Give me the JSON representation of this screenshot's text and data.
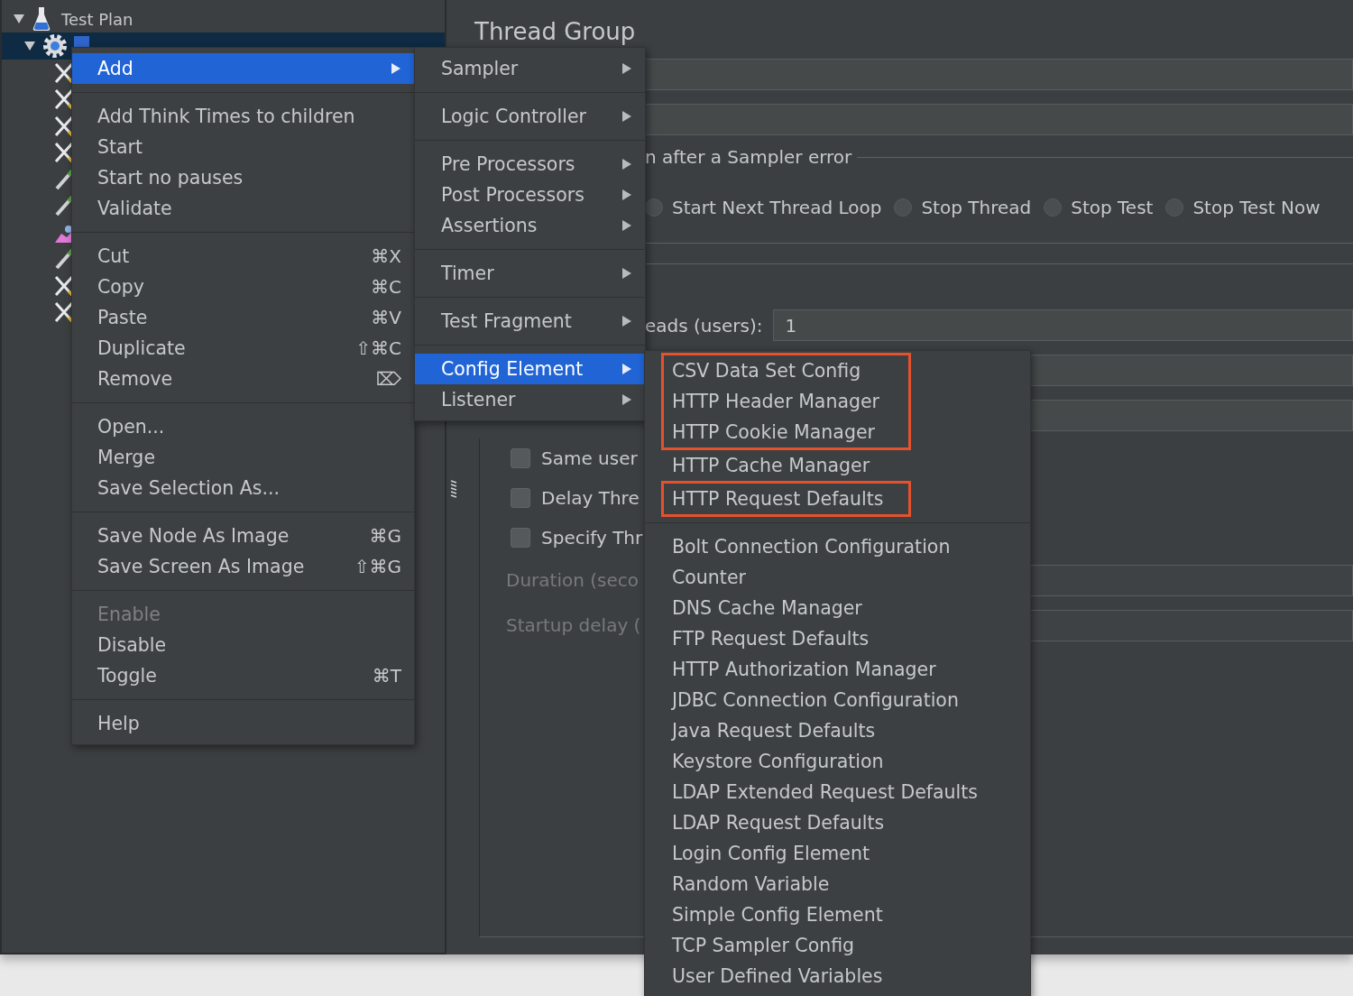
{
  "tree": {
    "label": "Test Plan",
    "kind": "flask",
    "expanded": true,
    "selected": false,
    "children": [
      {
        "kind": "gear",
        "expanded": true,
        "selected": true,
        "children": [
          {
            "kind": "tools",
            "selected": false
          },
          {
            "kind": "tools",
            "selected": false
          },
          {
            "kind": "tools",
            "selected": false
          },
          {
            "kind": "tools",
            "selected": false
          },
          {
            "kind": "pencil",
            "selected": false
          },
          {
            "kind": "pencil",
            "selected": false
          },
          {
            "kind": "chart",
            "selected": false
          },
          {
            "kind": "pencil",
            "selected": false
          },
          {
            "kind": "tools",
            "selected": false
          },
          {
            "kind": "tools",
            "selected": false
          }
        ]
      }
    ]
  },
  "panel": {
    "title": "Thread Group",
    "error_group": {
      "legend": "n after a Sampler error",
      "options": [
        {
          "label": "Start Next Thread Loop",
          "selected": false
        },
        {
          "label": "Stop Thread",
          "selected": false
        },
        {
          "label": "Stop Test",
          "selected": false
        },
        {
          "label": "Stop Test Now",
          "selected": false
        }
      ]
    },
    "threads": {
      "label": "eads (users):",
      "value": "1"
    },
    "checkboxes": [
      {
        "label": "Same user",
        "checked": false
      },
      {
        "label": "Delay Thre",
        "checked": false
      },
      {
        "label": "Specify Thr",
        "checked": false
      }
    ],
    "timing_fields": [
      {
        "label": "Duration (seco",
        "disabled": true
      },
      {
        "label": "Startup delay (",
        "disabled": true
      }
    ]
  },
  "context_menu": {
    "sections": [
      {
        "items": [
          {
            "label": "Add",
            "submenu": true,
            "selected": true,
            "disabled": false
          }
        ]
      },
      {
        "items": [
          {
            "label": "Add Think Times to children",
            "submenu": false,
            "selected": false,
            "disabled": false
          },
          {
            "label": "Start",
            "submenu": false,
            "selected": false,
            "disabled": false
          },
          {
            "label": "Start no pauses",
            "submenu": false,
            "selected": false,
            "disabled": false
          },
          {
            "label": "Validate",
            "submenu": false,
            "selected": false,
            "disabled": false
          }
        ]
      },
      {
        "items": [
          {
            "label": "Cut",
            "shortcut": "⌘X",
            "submenu": false,
            "selected": false,
            "disabled": false
          },
          {
            "label": "Copy",
            "shortcut": "⌘C",
            "submenu": false,
            "selected": false,
            "disabled": false
          },
          {
            "label": "Paste",
            "shortcut": "⌘V",
            "submenu": false,
            "selected": false,
            "disabled": false
          },
          {
            "label": "Duplicate",
            "shortcut": "⇧⌘C",
            "submenu": false,
            "selected": false,
            "disabled": false
          },
          {
            "label": "Remove",
            "shortcut": "⌦",
            "submenu": false,
            "selected": false,
            "disabled": false
          }
        ]
      },
      {
        "items": [
          {
            "label": "Open...",
            "submenu": false,
            "selected": false,
            "disabled": false
          },
          {
            "label": "Merge",
            "submenu": false,
            "selected": false,
            "disabled": false
          },
          {
            "label": "Save Selection As...",
            "submenu": false,
            "selected": false,
            "disabled": false
          }
        ]
      },
      {
        "items": [
          {
            "label": "Save Node As Image",
            "shortcut": "⌘G",
            "submenu": false,
            "selected": false,
            "disabled": false
          },
          {
            "label": "Save Screen As Image",
            "shortcut": "⇧⌘G",
            "submenu": false,
            "selected": false,
            "disabled": false
          }
        ]
      },
      {
        "items": [
          {
            "label": "Enable",
            "submenu": false,
            "selected": false,
            "disabled": true
          },
          {
            "label": "Disable",
            "submenu": false,
            "selected": false,
            "disabled": false
          },
          {
            "label": "Toggle",
            "shortcut": "⌘T",
            "submenu": false,
            "selected": false,
            "disabled": false
          }
        ]
      },
      {
        "items": [
          {
            "label": "Help",
            "submenu": false,
            "selected": false,
            "disabled": false
          }
        ]
      }
    ]
  },
  "add_submenu": {
    "sections": [
      {
        "items": [
          {
            "label": "Sampler",
            "submenu": true,
            "selected": false
          }
        ]
      },
      {
        "items": [
          {
            "label": "Logic Controller",
            "submenu": true,
            "selected": false
          }
        ]
      },
      {
        "items": [
          {
            "label": "Pre Processors",
            "submenu": true,
            "selected": false
          },
          {
            "label": "Post Processors",
            "submenu": true,
            "selected": false
          },
          {
            "label": "Assertions",
            "submenu": true,
            "selected": false
          }
        ]
      },
      {
        "items": [
          {
            "label": "Timer",
            "submenu": true,
            "selected": false
          }
        ]
      },
      {
        "items": [
          {
            "label": "Test Fragment",
            "submenu": true,
            "selected": false
          }
        ]
      },
      {
        "items": [
          {
            "label": "Config Element",
            "submenu": true,
            "selected": true
          },
          {
            "label": "Listener",
            "submenu": true,
            "selected": false
          }
        ]
      }
    ]
  },
  "config_submenu": {
    "sections": [
      {
        "groups": [
          {
            "highlighted": true,
            "items": [
              "CSV Data Set Config",
              "HTTP Header Manager",
              "HTTP Cookie Manager"
            ]
          },
          {
            "highlighted": false,
            "items": [
              "HTTP Cache Manager"
            ]
          },
          {
            "highlighted": true,
            "items": [
              "HTTP Request Defaults"
            ]
          }
        ]
      },
      {
        "groups": [
          {
            "highlighted": false,
            "items": [
              "Bolt Connection Configuration",
              "Counter",
              "DNS Cache Manager",
              "FTP Request Defaults",
              "HTTP Authorization Manager",
              "JDBC Connection Configuration",
              "Java Request Defaults",
              "Keystore Configuration",
              "LDAP Extended Request Defaults",
              "LDAP Request Defaults",
              "Login Config Element",
              "Random Variable",
              "Simple Config Element",
              "TCP Sampler Config",
              "User Defined Variables"
            ]
          }
        ]
      }
    ]
  }
}
